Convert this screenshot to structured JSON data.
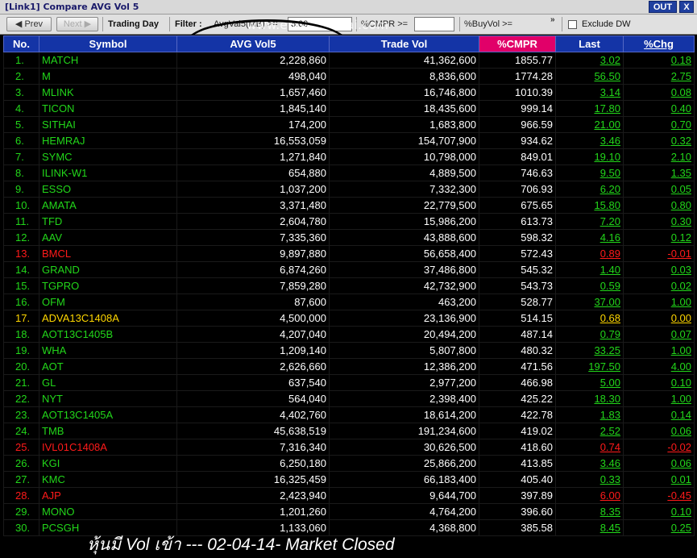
{
  "window": {
    "title": "[Link1] Compare AVG Vol 5",
    "out_label": "OUT",
    "close_label": "X"
  },
  "toolbar": {
    "prev_label": "◀ Prev",
    "next_label": "Next ▶",
    "trading_day_label": "Trading Day",
    "filter_label": "Filter :",
    "avgvol_label": "AvgVal5(MB) >=",
    "avgvol_value": "3.00",
    "cmpr_label": "%CMPR >=",
    "cmpr_value": "",
    "buyvol_label": "%BuyVol >=",
    "chevron": "»",
    "exclude_label": "Exclude DW",
    "watermark": "www.efinancethai.com"
  },
  "columns": [
    "No.",
    "Symbol",
    "AVG Vol5",
    "Trade Vol",
    "%CMPR",
    "Last",
    "%Chg"
  ],
  "colors": {
    "header": "#1434a6",
    "header_hot": "#e10069",
    "up": "#22d61a",
    "down": "#ff1a1a",
    "flat": "#ffd700"
  },
  "rows": [
    {
      "no": "1.",
      "symbol": "MATCH",
      "avg": "2,228,860",
      "trade": "41,362,600",
      "cmpr": "1855.77",
      "last": "3.02",
      "chg": "0.18",
      "dir": "up"
    },
    {
      "no": "2.",
      "symbol": "M",
      "avg": "498,040",
      "trade": "8,836,600",
      "cmpr": "1774.28",
      "last": "56.50",
      "chg": "2.75",
      "dir": "up"
    },
    {
      "no": "3.",
      "symbol": "MLINK",
      "avg": "1,657,460",
      "trade": "16,746,800",
      "cmpr": "1010.39",
      "last": "3.14",
      "chg": "0.08",
      "dir": "up"
    },
    {
      "no": "4.",
      "symbol": "TICON",
      "avg": "1,845,140",
      "trade": "18,435,600",
      "cmpr": "999.14",
      "last": "17.80",
      "chg": "0.40",
      "dir": "up"
    },
    {
      "no": "5.",
      "symbol": "SITHAI",
      "avg": "174,200",
      "trade": "1,683,800",
      "cmpr": "966.59",
      "last": "21.00",
      "chg": "0.70",
      "dir": "up"
    },
    {
      "no": "6.",
      "symbol": "HEMRAJ",
      "avg": "16,553,059",
      "trade": "154,707,900",
      "cmpr": "934.62",
      "last": "3.46",
      "chg": "0.32",
      "dir": "up"
    },
    {
      "no": "7.",
      "symbol": "SYMC",
      "avg": "1,271,840",
      "trade": "10,798,000",
      "cmpr": "849.01",
      "last": "19.10",
      "chg": "2.10",
      "dir": "up"
    },
    {
      "no": "8.",
      "symbol": "ILINK-W1",
      "avg": "654,880",
      "trade": "4,889,500",
      "cmpr": "746.63",
      "last": "9.50",
      "chg": "1.35",
      "dir": "up"
    },
    {
      "no": "9.",
      "symbol": "ESSO",
      "avg": "1,037,200",
      "trade": "7,332,300",
      "cmpr": "706.93",
      "last": "6.20",
      "chg": "0.05",
      "dir": "up"
    },
    {
      "no": "10.",
      "symbol": "AMATA",
      "avg": "3,371,480",
      "trade": "22,779,500",
      "cmpr": "675.65",
      "last": "15.80",
      "chg": "0.80",
      "dir": "up"
    },
    {
      "no": "11.",
      "symbol": "TFD",
      "avg": "2,604,780",
      "trade": "15,986,200",
      "cmpr": "613.73",
      "last": "7.20",
      "chg": "0.30",
      "dir": "up"
    },
    {
      "no": "12.",
      "symbol": "AAV",
      "avg": "7,335,360",
      "trade": "43,888,600",
      "cmpr": "598.32",
      "last": "4.16",
      "chg": "0.12",
      "dir": "up"
    },
    {
      "no": "13.",
      "symbol": "BMCL",
      "avg": "9,897,880",
      "trade": "56,658,400",
      "cmpr": "572.43",
      "last": "0.89",
      "chg": "-0.01",
      "dir": "down"
    },
    {
      "no": "14.",
      "symbol": "GRAND",
      "avg": "6,874,260",
      "trade": "37,486,800",
      "cmpr": "545.32",
      "last": "1.40",
      "chg": "0.03",
      "dir": "up"
    },
    {
      "no": "15.",
      "symbol": "TGPRO",
      "avg": "7,859,280",
      "trade": "42,732,900",
      "cmpr": "543.73",
      "last": "0.59",
      "chg": "0.02",
      "dir": "up"
    },
    {
      "no": "16.",
      "symbol": "OFM",
      "avg": "87,600",
      "trade": "463,200",
      "cmpr": "528.77",
      "last": "37.00",
      "chg": "1.00",
      "dir": "up"
    },
    {
      "no": "17.",
      "symbol": "ADVA13C1408A",
      "avg": "4,500,000",
      "trade": "23,136,900",
      "cmpr": "514.15",
      "last": "0.68",
      "chg": "0.00",
      "dir": "flat"
    },
    {
      "no": "18.",
      "symbol": "AOT13C1405B",
      "avg": "4,207,040",
      "trade": "20,494,200",
      "cmpr": "487.14",
      "last": "0.79",
      "chg": "0.07",
      "dir": "up"
    },
    {
      "no": "19.",
      "symbol": "WHA",
      "avg": "1,209,140",
      "trade": "5,807,800",
      "cmpr": "480.32",
      "last": "33.25",
      "chg": "1.00",
      "dir": "up"
    },
    {
      "no": "20.",
      "symbol": "AOT",
      "avg": "2,626,660",
      "trade": "12,386,200",
      "cmpr": "471.56",
      "last": "197.50",
      "chg": "4.00",
      "dir": "up"
    },
    {
      "no": "21.",
      "symbol": "GL",
      "avg": "637,540",
      "trade": "2,977,200",
      "cmpr": "466.98",
      "last": "5.00",
      "chg": "0.10",
      "dir": "up"
    },
    {
      "no": "22.",
      "symbol": "NYT",
      "avg": "564,040",
      "trade": "2,398,400",
      "cmpr": "425.22",
      "last": "18.30",
      "chg": "1.00",
      "dir": "up"
    },
    {
      "no": "23.",
      "symbol": "AOT13C1405A",
      "avg": "4,402,760",
      "trade": "18,614,200",
      "cmpr": "422.78",
      "last": "1.83",
      "chg": "0.14",
      "dir": "up"
    },
    {
      "no": "24.",
      "symbol": "TMB",
      "avg": "45,638,519",
      "trade": "191,234,600",
      "cmpr": "419.02",
      "last": "2.52",
      "chg": "0.06",
      "dir": "up"
    },
    {
      "no": "25.",
      "symbol": "IVL01C1408A",
      "avg": "7,316,340",
      "trade": "30,626,500",
      "cmpr": "418.60",
      "last": "0.74",
      "chg": "-0.02",
      "dir": "down"
    },
    {
      "no": "26.",
      "symbol": "KGI",
      "avg": "6,250,180",
      "trade": "25,866,200",
      "cmpr": "413.85",
      "last": "3.46",
      "chg": "0.06",
      "dir": "up"
    },
    {
      "no": "27.",
      "symbol": "KMC",
      "avg": "16,325,459",
      "trade": "66,183,400",
      "cmpr": "405.40",
      "last": "0.33",
      "chg": "0.01",
      "dir": "up"
    },
    {
      "no": "28.",
      "symbol": "AJP",
      "avg": "2,423,940",
      "trade": "9,644,700",
      "cmpr": "397.89",
      "last": "6.00",
      "chg": "-0.45",
      "dir": "down"
    },
    {
      "no": "29.",
      "symbol": "MONO",
      "avg": "1,201,260",
      "trade": "4,764,200",
      "cmpr": "396.60",
      "last": "8.35",
      "chg": "0.10",
      "dir": "up"
    },
    {
      "no": "30.",
      "symbol": "PCSGH",
      "avg": "1,133,060",
      "trade": "4,368,800",
      "cmpr": "385.58",
      "last": "8.45",
      "chg": "0.25",
      "dir": "up"
    }
  ],
  "footer": {
    "caption": "หุ้นมี Vol เข้า --- 02-04-14- Market Closed"
  }
}
